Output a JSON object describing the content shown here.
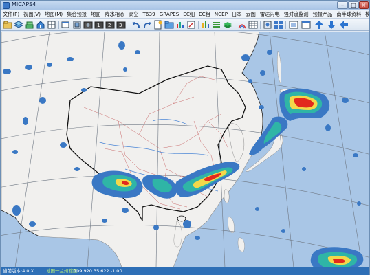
{
  "window": {
    "title": "MICAPS4"
  },
  "menu": [
    "文件(F)",
    "视图(V)",
    "地图(M)",
    "集合预报",
    "地面",
    "降水相态",
    "高空",
    "T639",
    "GRAPES",
    "EC细",
    "EC粗",
    "NCEP",
    "日本",
    "云图",
    "雷达闪电",
    "强对流监测",
    "预报产品",
    "南半球资料",
    "模式降水"
  ],
  "toolbar_icons": [
    "open-file-icon",
    "layers-icon",
    "stack-icon",
    "home-icon",
    "grid-icon",
    "window-icon",
    "zoom-extent-icon",
    "camera-icon",
    "save-image-icon",
    "export-image-icon",
    "print-icon",
    "undo-icon",
    "redo-icon",
    "document-star-icon",
    "folder-icon",
    "chart-icon",
    "edit-icon",
    "graph-icon",
    "bars-icon",
    "3d-layers-icon",
    "signal-icon",
    "table-icon",
    "settings-icon",
    "grid-view-icon",
    "arrow-up-icon",
    "arrow-down-icon",
    "arrow-left-icon"
  ],
  "status": {
    "version": "当前版本:4.0.X",
    "layer": "地图一兰州辖区",
    "coords": "109.920 35.622 -1.00"
  },
  "colors": {
    "ocean": "#a9c6e6",
    "land": "#f1f0ee",
    "rain_light": "#3a78c4",
    "rain_mid": "#2fb5a6",
    "rain_heavy": "#f3d84a",
    "rain_extreme": "#e22a1d",
    "status_bg": "#2e6fb6"
  }
}
